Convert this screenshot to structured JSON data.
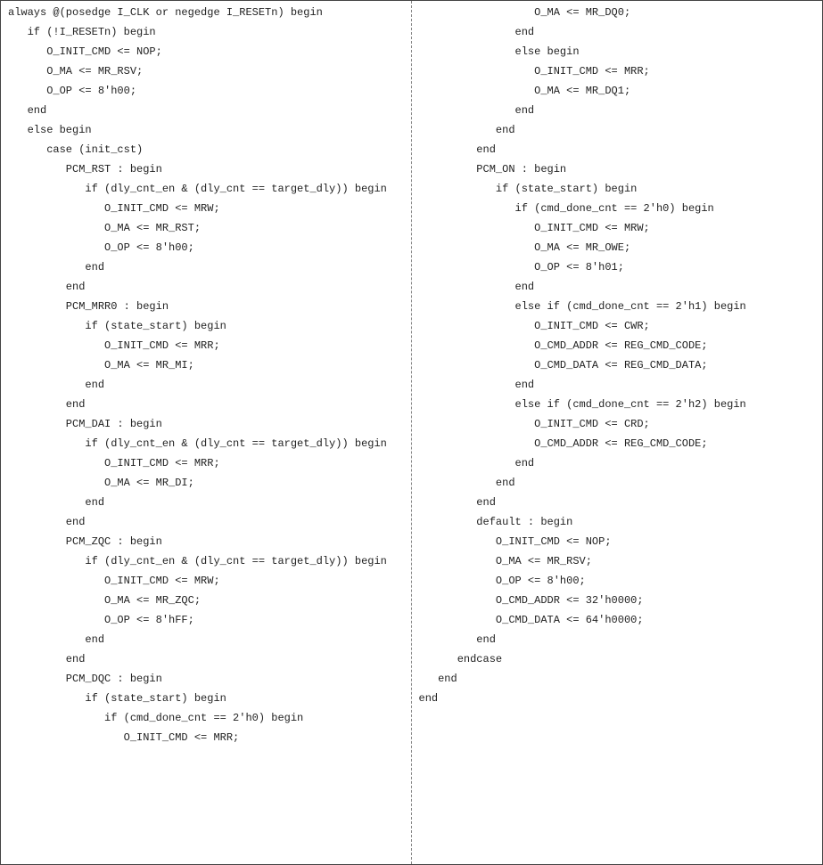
{
  "left": {
    "l1": "always @(posedge I_CLK or negedge I_RESETn) begin",
    "l2": "   if (!I_RESETn) begin",
    "l3": "      O_INIT_CMD <= NOP;",
    "l4": "      O_MA <= MR_RSV;",
    "l5": "      O_OP <= 8'h00;",
    "l6": "   end",
    "l7": "   else begin",
    "l8": "      case (init_cst)",
    "l9": "         PCM_RST : begin",
    "l10": "            if (dly_cnt_en & (dly_cnt == target_dly)) begin",
    "l11": "               O_INIT_CMD <= MRW;",
    "l12": "               O_MA <= MR_RST;",
    "l13": "               O_OP <= 8'h00;",
    "l14": "            end",
    "l15": "         end",
    "l16": "         PCM_MRR0 : begin",
    "l17": "            if (state_start) begin",
    "l18": "               O_INIT_CMD <= MRR;",
    "l19": "               O_MA <= MR_MI;",
    "l20": "            end",
    "l21": "         end",
    "l22": "         PCM_DAI : begin",
    "l23": "            if (dly_cnt_en & (dly_cnt == target_dly)) begin",
    "l24": "               O_INIT_CMD <= MRR;",
    "l25": "               O_MA <= MR_DI;",
    "l26": "            end",
    "l27": "         end",
    "l28": "         PCM_ZQC : begin",
    "l29": "            if (dly_cnt_en & (dly_cnt == target_dly)) begin",
    "l30": "               O_INIT_CMD <= MRW;",
    "l31": "               O_MA <= MR_ZQC;",
    "l32": "               O_OP <= 8'hFF;",
    "l33": "            end",
    "l34": "         end",
    "l35": "         PCM_DQC : begin",
    "l36": "            if (state_start) begin",
    "l37": "               if (cmd_done_cnt == 2'h0) begin",
    "l38": "                  O_INIT_CMD <= MRR;"
  },
  "right": {
    "r1": "                  O_MA <= MR_DQ0;",
    "r2": "               end",
    "r3": "               else begin",
    "r4": "                  O_INIT_CMD <= MRR;",
    "r5": "                  O_MA <= MR_DQ1;",
    "r6": "               end",
    "r7": "            end",
    "r8": "         end",
    "r9": "         PCM_ON : begin",
    "r10": "            if (state_start) begin",
    "r11": "               if (cmd_done_cnt == 2'h0) begin",
    "r12": "                  O_INIT_CMD <= MRW;",
    "r13": "                  O_MA <= MR_OWE;",
    "r14": "                  O_OP <= 8'h01;",
    "r15": "               end",
    "r16": "               else if (cmd_done_cnt == 2'h1) begin",
    "r17": "                  O_INIT_CMD <= CWR;",
    "r18": "                  O_CMD_ADDR <= REG_CMD_CODE;",
    "r19": "                  O_CMD_DATA <= REG_CMD_DATA;",
    "r20": "               end",
    "r21": "               else if (cmd_done_cnt == 2'h2) begin",
    "r22": "                  O_INIT_CMD <= CRD;",
    "r23": "                  O_CMD_ADDR <= REG_CMD_CODE;",
    "r24": "               end",
    "r25": "            end",
    "r26": "         end",
    "r27": "         default : begin",
    "r28": "            O_INIT_CMD <= NOP;",
    "r29": "            O_MA <= MR_RSV;",
    "r30": "            O_OP <= 8'h00;",
    "r31": "            O_CMD_ADDR <= 32'h0000;",
    "r32": "            O_CMD_DATA <= 64'h0000;",
    "r33": "         end",
    "r34": "      endcase",
    "r35": "   end",
    "r36": "end"
  }
}
